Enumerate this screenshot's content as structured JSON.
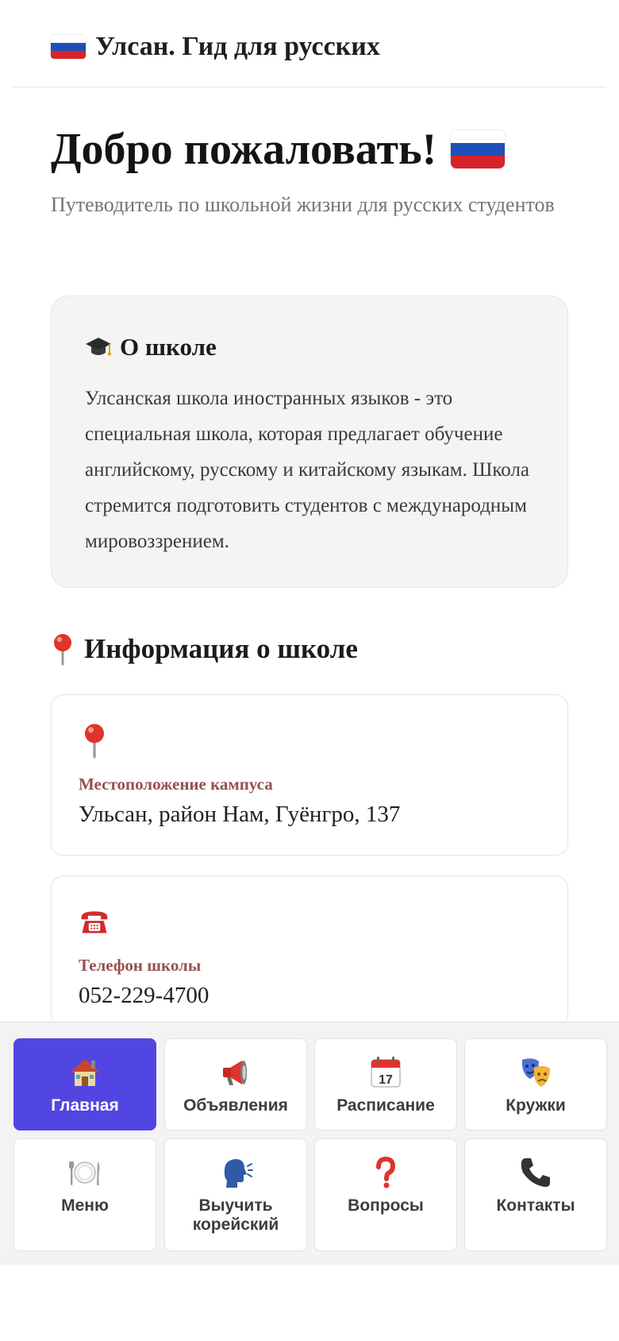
{
  "header": {
    "title": "Улсан. Гид для русских"
  },
  "welcome": {
    "title": "Добро пожаловать!",
    "subtitle": "Путеводитель по школьной жизни для русских студентов"
  },
  "about": {
    "icon": "graduation-cap-icon",
    "heading": "О школе",
    "text": "Улсанская школа иностранных языков - это специальная школа, которая предлагает обучение английскому, русскому и китайскому языкам. Школа стремится подготовить студентов с международным мировоззрением."
  },
  "info": {
    "icon": "pin-icon",
    "heading": "Информация о школе",
    "cards": [
      {
        "icon": "pin-icon",
        "label": "Местоположение кампуса",
        "value": "Ульсан, район Нам, Гуёнгро, 137"
      },
      {
        "icon": "telephone-icon",
        "label": "Телефон школы",
        "value": "052-229-4700"
      }
    ]
  },
  "nav": {
    "active_color": "#5246e2",
    "items": [
      {
        "icon": "house-icon",
        "label": "Главная",
        "active": true
      },
      {
        "icon": "megaphone-icon",
        "label": "Объявления"
      },
      {
        "icon": "calendar-icon",
        "label": "Расписание",
        "calendar_day": "17"
      },
      {
        "icon": "theater-masks-icon",
        "label": "Кружки"
      },
      {
        "icon": "plate-cutlery-icon",
        "label": "Меню"
      },
      {
        "icon": "speaking-head-icon",
        "label": "Выучить корейский"
      },
      {
        "icon": "question-mark-icon",
        "label": "Вопросы"
      },
      {
        "icon": "phone-receiver-icon",
        "label": "Контакты"
      }
    ]
  }
}
